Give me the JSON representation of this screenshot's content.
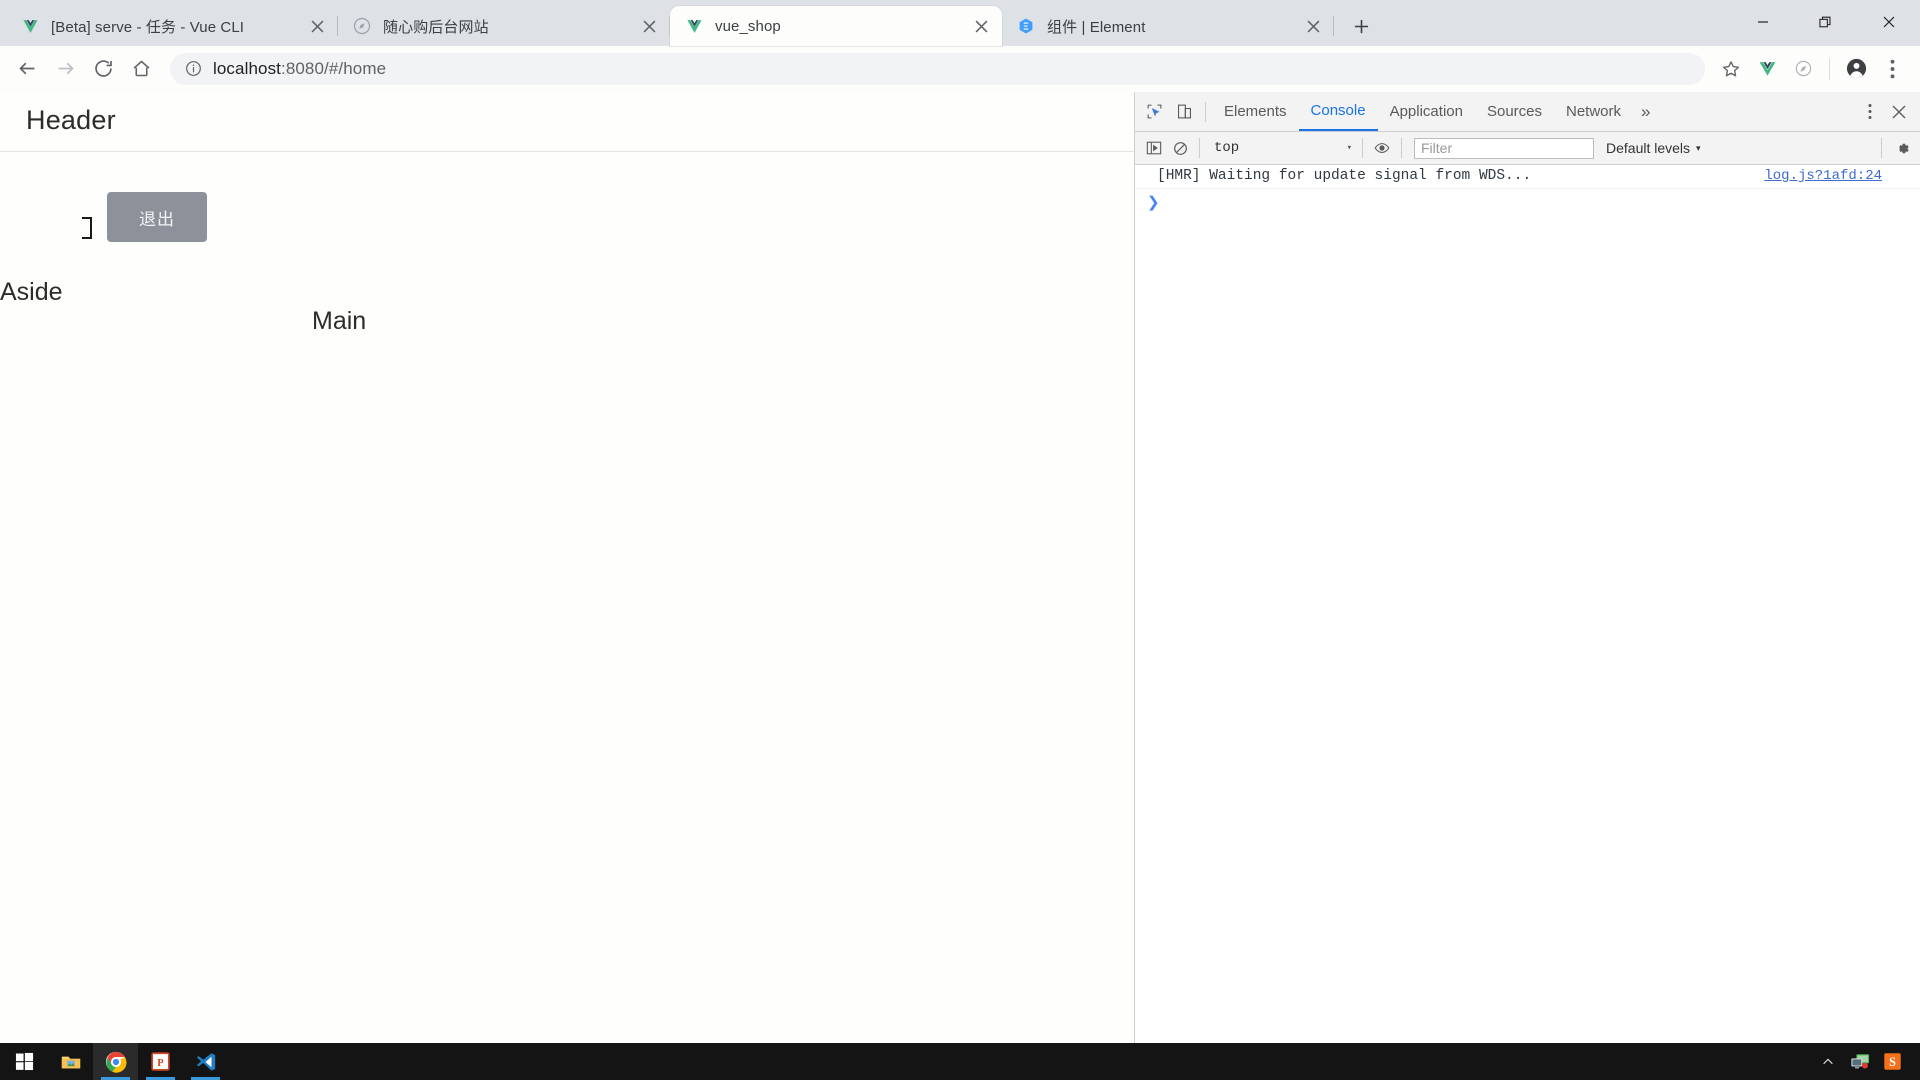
{
  "browser": {
    "tabs": [
      {
        "title": "[Beta] serve - 任务 - Vue CLI",
        "favicon": "vue-logo-icon",
        "active": false
      },
      {
        "title": "随心购后台网站",
        "favicon": "compass-icon",
        "active": false
      },
      {
        "title": "vue_shop",
        "favicon": "vue-logo-icon",
        "active": true
      },
      {
        "title": "组件 | Element",
        "favicon": "element-ui-icon",
        "active": false
      }
    ],
    "new_tab_label": "+",
    "window_controls": {
      "minimize": "minimize-icon",
      "restore": "restore-icon",
      "close": "close-icon"
    },
    "toolbar": {
      "back": "back-arrow-icon",
      "forward": "forward-arrow-icon",
      "reload": "reload-icon",
      "home": "home-icon",
      "site_info": "info-circle-icon",
      "url_host": "localhost",
      "url_rest": ":8080/#/home",
      "url_full": "localhost:8080/#/home",
      "bookmark": "star-icon",
      "extension_vue": "vue-devtools-icon",
      "extension_circle": "circle-extension-icon",
      "profile": "account-avatar-icon",
      "menu": "three-dot-menu-icon"
    }
  },
  "page": {
    "header_label": "Header",
    "logout_button": "退出",
    "aside_label": "Aside",
    "main_label": "Main"
  },
  "devtools": {
    "inspect_icon": "inspect-element-icon",
    "device_icon": "device-toolbar-icon",
    "tabs": [
      {
        "label": "Elements",
        "selected": false
      },
      {
        "label": "Console",
        "selected": true
      },
      {
        "label": "Application",
        "selected": false
      },
      {
        "label": "Sources",
        "selected": false
      },
      {
        "label": "Network",
        "selected": false
      }
    ],
    "more_tabs": "»",
    "kebab_menu": "three-dot-menu-icon",
    "close": "close-icon",
    "console_toolbar": {
      "sidebar_toggle": "console-sidebar-icon",
      "clear_console": "clear-console-icon",
      "context": "top",
      "context_caret": "▾",
      "eye_icon": "live-expression-icon",
      "filter_placeholder": "Filter",
      "filter_value": "",
      "levels_label": "Default levels",
      "levels_caret": "▾",
      "settings": "gear-icon"
    },
    "messages": [
      {
        "text": "[HMR] Waiting for update signal from WDS...",
        "source": "log.js?1afd:24"
      }
    ],
    "prompt_caret": "❯"
  },
  "taskbar": {
    "start": "windows-start-icon",
    "apps": [
      {
        "name": "file-explorer-icon",
        "running": false,
        "active": false
      },
      {
        "name": "google-chrome-icon",
        "running": true,
        "active": true
      },
      {
        "name": "powerpoint-icon",
        "running": true,
        "active": false
      },
      {
        "name": "vscode-icon",
        "running": true,
        "active": false
      }
    ],
    "tray": [
      {
        "name": "show-hidden-icons-chevron"
      },
      {
        "name": "network-display-icon"
      },
      {
        "name": "sogou-ime-icon",
        "label": "S"
      }
    ]
  },
  "colors": {
    "chrome_frame": "#dee1e6",
    "tab_active": "#fdfdfb",
    "devtools_selected": "#1a73e8",
    "logout_button_bg": "#8d919a",
    "console_link": "#3f6ad0",
    "taskbar_bg": "#141414"
  }
}
